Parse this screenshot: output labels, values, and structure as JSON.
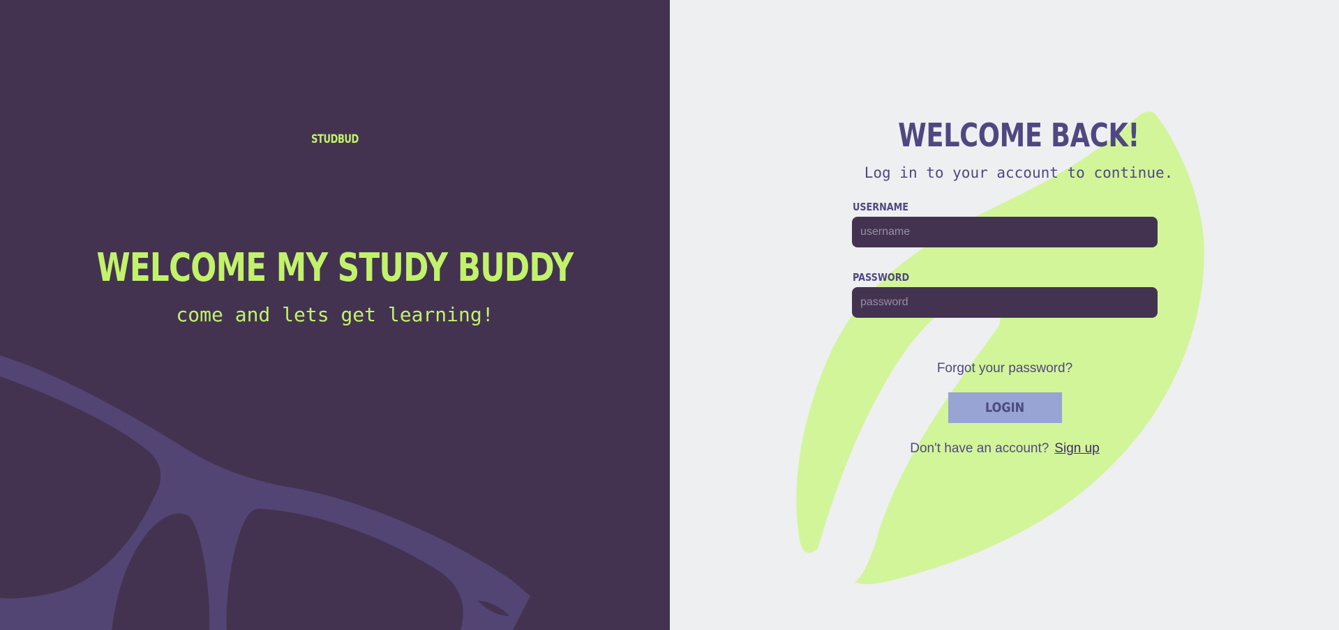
{
  "left_panel": {
    "brand": "STUDBUD",
    "title": "WELCOME MY STUDY BUDDY",
    "subtitle": "come and lets get learning!"
  },
  "login": {
    "title": "WELCOME BACK!",
    "subtitle": "Log in to your account to continue.",
    "username_label": "USERNAME",
    "username_placeholder": "username",
    "password_label": "PASSWORD",
    "password_placeholder": "password",
    "forgot_label": "Forgot your password?",
    "login_button": "LOGIN",
    "signup_prompt": "Don't have an account?",
    "signup_link": "Sign up"
  },
  "colors": {
    "left_bg": "#433350",
    "right_bg": "#eeeff1",
    "accent_green": "#c2f26b",
    "leaf_green": "#d2f59a",
    "text_purple": "#4f4880",
    "glasses_purple": "#524573",
    "button_blue": "#97a4d4"
  },
  "icons": {
    "decoration_left": "glasses-illustration",
    "decoration_right": "leaf-illustration"
  }
}
